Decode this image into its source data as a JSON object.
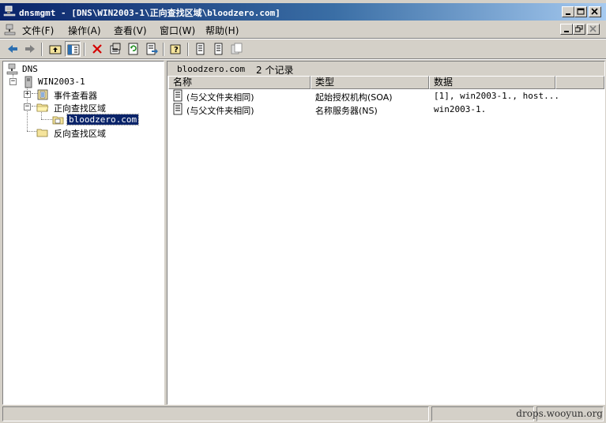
{
  "window": {
    "title": "dnsmgmt - [DNS\\WIN2003-1\\正向查找区域\\bloodzero.com]"
  },
  "menu": {
    "items": [
      {
        "label": "文件(F)"
      },
      {
        "label": "操作(A)"
      },
      {
        "label": "查看(V)"
      },
      {
        "label": "窗口(W)"
      },
      {
        "label": "帮助(H)"
      }
    ]
  },
  "toolbar": {
    "icons": [
      "back-arrow-icon",
      "forward-arrow-icon",
      "up-folder-icon",
      "show-tree-icon",
      "delete-icon",
      "properties-icon",
      "refresh-icon",
      "export-list-icon",
      "help-icon",
      "new-record-icon",
      "new-record-2-icon",
      "new-record-3-icon"
    ]
  },
  "tree": {
    "root": "DNS",
    "server": "WIN2003-1",
    "event_viewer": "事件查看器",
    "forward_zones": "正向查找区域",
    "selected_zone": "bloodzero.com",
    "reverse_zones": "反向查找区域"
  },
  "content": {
    "zone_name": "bloodzero.com",
    "record_count": "2 个记录",
    "columns": [
      "名称",
      "类型",
      "数据"
    ],
    "rows": [
      {
        "name": "(与父文件夹相同)",
        "type": "起始授权机构(SOA)",
        "data": "[1], win2003-1., host..."
      },
      {
        "name": "(与父文件夹相同)",
        "type": "名称服务器(NS)",
        "data": "win2003-1."
      }
    ]
  },
  "statusbar": {
    "watermark": "drops.wooyun.org"
  },
  "colors": {
    "title_gradient_start": "#0a246a",
    "title_gradient_end": "#a6caf0",
    "selection": "#0a246a",
    "face": "#d4d0c8"
  }
}
